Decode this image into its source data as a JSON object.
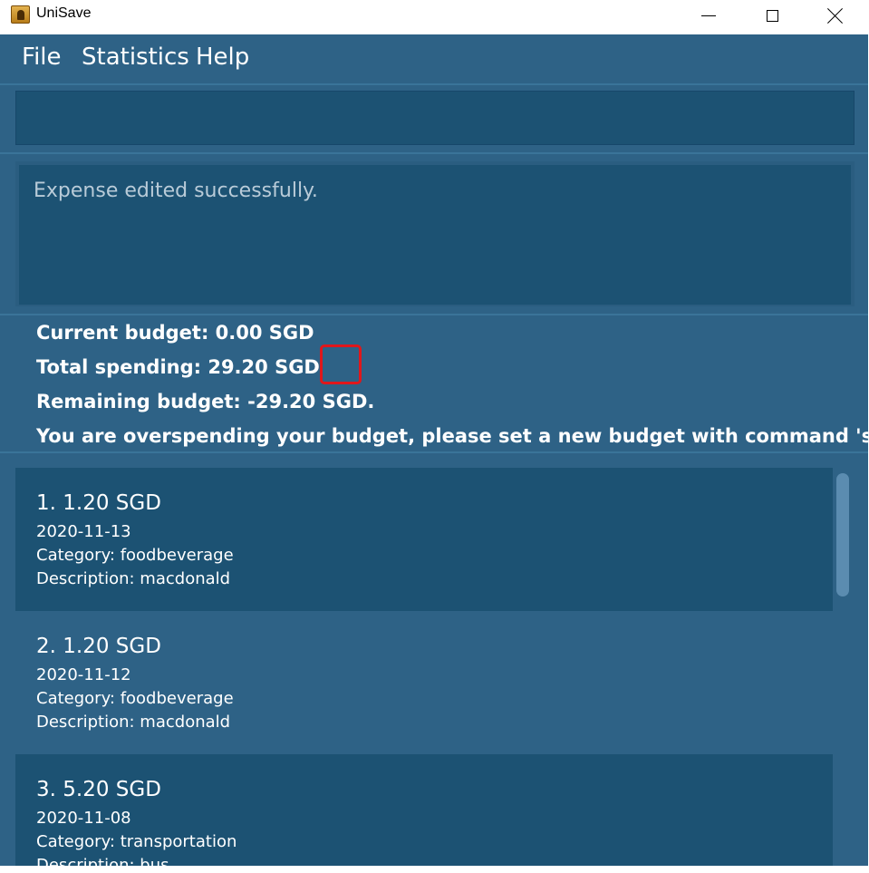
{
  "window": {
    "title": "UniSave",
    "icon": "app-icon"
  },
  "menu": {
    "items": [
      "File",
      "Statistics",
      "Help"
    ]
  },
  "command_input": {
    "value": "",
    "placeholder": ""
  },
  "result": {
    "message": "Expense edited successfully."
  },
  "budget": {
    "current": "Current budget: 0.00 SGD",
    "total_spending": "Total spending: 29.20 SGD",
    "remaining": "Remaining budget: -29.20 SGD.",
    "warning": "You are overspending your budget, please set a new budget with command 'set..."
  },
  "expenses": [
    {
      "title": "1.  1.20 SGD",
      "date": "2020-11-13",
      "category": "Category: foodbeverage",
      "description": "Description: macdonald"
    },
    {
      "title": "2.  1.20 SGD",
      "date": "2020-11-12",
      "category": "Category: foodbeverage",
      "description": "Description: macdonald"
    },
    {
      "title": "3.  5.20 SGD",
      "date": "2020-11-08",
      "category": "Category: transportation",
      "description": "Description: bus"
    }
  ],
  "colors": {
    "background": "#2e6286",
    "panel": "#1c5273",
    "highlight": "#e0171b",
    "scroll_thumb": "#5b8cb0"
  }
}
